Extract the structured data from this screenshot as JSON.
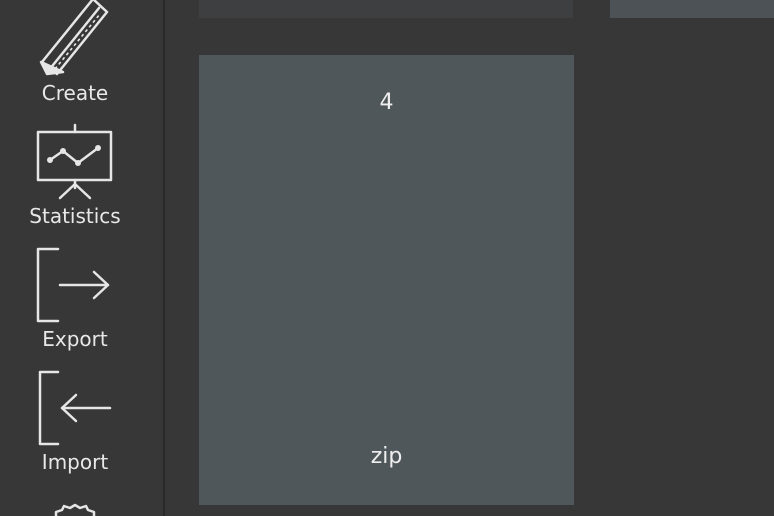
{
  "sidebar": {
    "items": [
      {
        "label": "Create",
        "icon": "pencil-icon"
      },
      {
        "label": "Statistics",
        "icon": "presentation-chart-icon"
      },
      {
        "label": "Export",
        "icon": "export-icon"
      },
      {
        "label": "Import",
        "icon": "import-icon"
      },
      {
        "label": "",
        "icon": "gear-icon"
      }
    ]
  },
  "main": {
    "cards": [
      {
        "number": "4",
        "extension": "zip"
      }
    ]
  },
  "colors": {
    "background": "#373737",
    "card": "#50575a",
    "text": "#e8e8e8"
  }
}
